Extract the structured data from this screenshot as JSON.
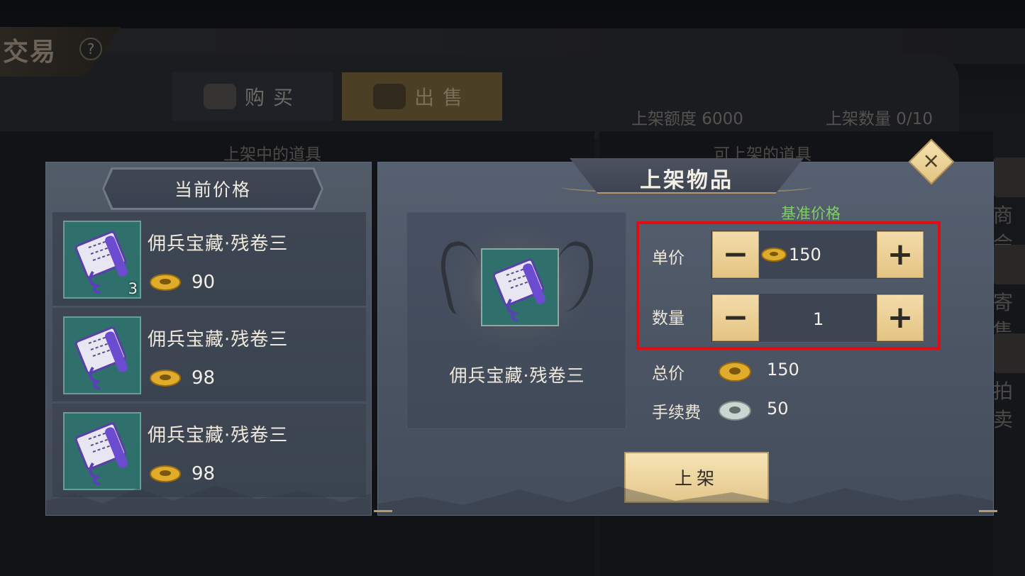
{
  "background": {
    "title": "交易",
    "help_symbol": "?",
    "tabs": [
      {
        "label": "购买",
        "icon": "coins-icon",
        "active": false
      },
      {
        "label": "出售",
        "icon": "treasure-chest-icon",
        "active": true
      }
    ],
    "listing_quota": "上架额度 6000",
    "listing_count": "上架数量 0/10",
    "columns": [
      "上架中的道具",
      "可上架的道具"
    ],
    "side_menu": [
      {
        "label": "商会",
        "icon": "guild-icon"
      },
      {
        "label": "寄售",
        "icon": "consign-icon"
      },
      {
        "label": "拍卖",
        "icon": "auction-icon"
      }
    ]
  },
  "current_price": {
    "title": "当前价格",
    "items": [
      {
        "name": "佣兵宝藏·残卷三",
        "price": "90",
        "count": "3"
      },
      {
        "name": "佣兵宝藏·残卷三",
        "price": "98",
        "count": ""
      },
      {
        "name": "佣兵宝藏·残卷三",
        "price": "98",
        "count": ""
      }
    ]
  },
  "listing_dialog": {
    "title": "上架物品",
    "close_symbol": "×",
    "item_name": "佣兵宝藏·残卷三",
    "base_price_label": "基准价格",
    "unit_price_label": "单价",
    "unit_price_value": "150",
    "quantity_label": "数量",
    "quantity_value": "1",
    "minus_symbol": "−",
    "plus_symbol": "+",
    "total_label": "总价",
    "total_value": "150",
    "fee_label": "手续费",
    "fee_value": "50",
    "confirm_label": "上架"
  },
  "colors": {
    "gold_button": "#e9cc8f",
    "highlight_border": "#e00e12",
    "base_price_green": "#7fcf64",
    "item_slot_teal": "#2f6f6c"
  }
}
